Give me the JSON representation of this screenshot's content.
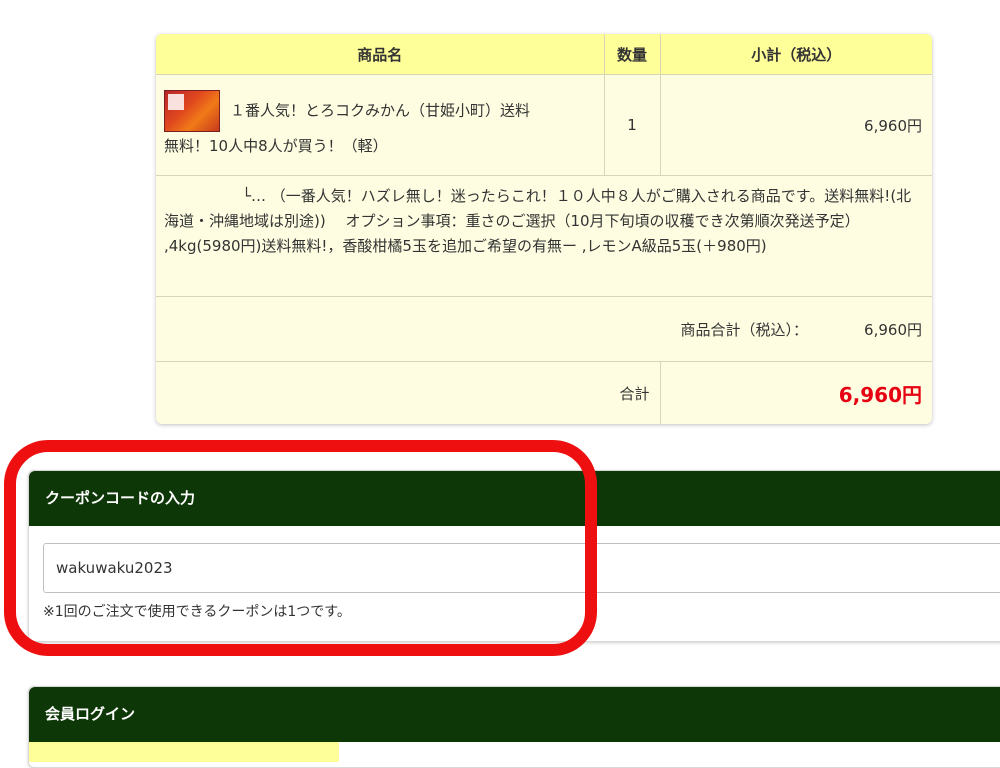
{
  "cart": {
    "headers": {
      "name": "商品名",
      "qty": "数量",
      "subtotal": "小計（税込）"
    },
    "item": {
      "name_line1": "１番人気！とろコクみかん（甘姫小町）送料",
      "name_line2": "無料！10人中8人が買う！（軽）",
      "qty": "1",
      "subtotal": "6,960円",
      "option_text": "└… （一番人気！ハズレ無し！迷ったらこれ！１０人中８人がご購入される商品です。送料無料!(北海道・沖縄地域は別途))　 オプション事項：重さのご選択（10月下旬頃の収穫でき次第順次発送予定） ,4kg(5980円)送料無料!，香酸柑橘5玉を追加ご希望の有無ー ,レモンA級品5玉(＋980円)"
    },
    "goods_total_label": "商品合計（税込）：",
    "goods_total_value": "6,960円",
    "total_label": "合計",
    "total_value": "6,960円",
    "total_color": "#e60012"
  },
  "coupon": {
    "title": "クーポンコードの入力",
    "input_value": "wakuwaku2023",
    "note": "※1回のご注文で使用できるクーポンは1つです。"
  },
  "login": {
    "title": "会員ログイン"
  },
  "colors": {
    "header_green": "#0e3708",
    "header_yellow": "#ffff9a",
    "highlight_red": "#ee1010"
  }
}
